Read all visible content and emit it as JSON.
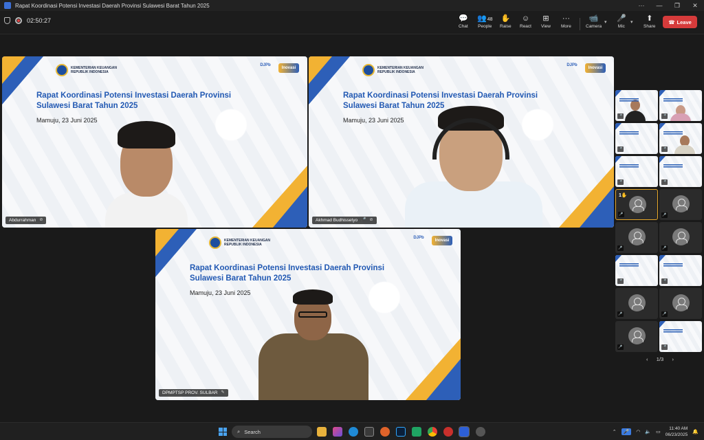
{
  "window": {
    "title": "Rapat Koordinasi Potensi Investasi Daerah Provinsi Sulawesi Barat Tahun 2025",
    "controls": [
      "···",
      "—",
      "❐",
      "✕"
    ]
  },
  "toolbar": {
    "timer": "02:50:27",
    "buttons": {
      "chat": {
        "label": "Chat",
        "icon": "💬"
      },
      "people": {
        "label": "People",
        "icon": "👥",
        "count": "48"
      },
      "raise": {
        "label": "Raise",
        "icon": "✋"
      },
      "react": {
        "label": "React",
        "icon": "☺"
      },
      "view": {
        "label": "View",
        "icon": "⊞"
      },
      "more": {
        "label": "More",
        "icon": "···"
      },
      "camera": {
        "label": "Camera",
        "icon": "📹"
      },
      "mic": {
        "label": "Mic",
        "icon": "🎤"
      },
      "share": {
        "label": "Share",
        "icon": "⬆"
      }
    },
    "leave_label": "Leave",
    "leave_icon": "☎",
    "accent_red": "#d63b3b"
  },
  "slide": {
    "ministry_line1": "KEMENTERIAN KEUANGAN",
    "ministry_line2": "REPUBLIK INDONESIA",
    "logo_a": "DJPb",
    "logo_b": "Inovasi",
    "title": "Rapat Koordinasi Potensi Investasi Daerah Provinsi Sulawesi Barat Tahun 2025",
    "date": "Mamuju, 23 Juni 2025"
  },
  "tiles": [
    {
      "name": "Abdurrahman",
      "mic_icon": "⊘"
    },
    {
      "name": "Akhmad Budhissetyo",
      "mic_icon": "🎤",
      "cam_icon": "⊘"
    },
    {
      "name": "DPMPTSP PROV. SULBAR",
      "mic_icon": "✎"
    }
  ],
  "gallery": {
    "raised_count": "1",
    "raised_icon": "✋",
    "mic_icon": "🎤",
    "page": "1/3",
    "prev": "‹",
    "next": "›"
  },
  "taskbar": {
    "search_label": "Search",
    "time": "11:40 AM",
    "date": "06/23/2025"
  }
}
